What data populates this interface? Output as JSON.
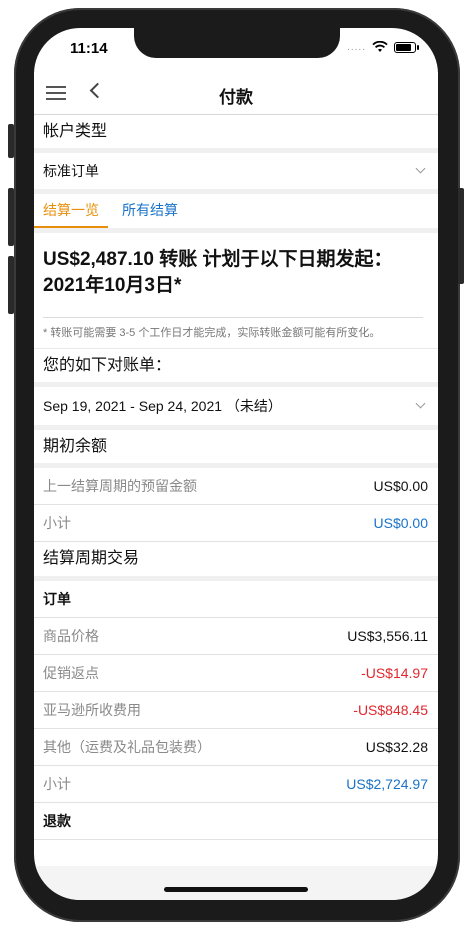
{
  "status": {
    "time": "11:14",
    "signal": "....."
  },
  "nav": {
    "title": "付款"
  },
  "account_type": {
    "heading": "帐户类型",
    "selected": "标准订单"
  },
  "tabs": [
    {
      "label": "结算一览"
    },
    {
      "label": "所有结算"
    }
  ],
  "summary": {
    "amount_text": "US$2,487.10 转账 计划于以下日期发起：2021年10月3日*",
    "note": "* 转账可能需要 3-5 个工作日才能完成，实际转账金额可能有所变化。"
  },
  "statement": {
    "heading": "您的如下对账单：",
    "selected": "Sep 19, 2021 - Sep 24, 2021 （未结）"
  },
  "opening_balance": {
    "heading": "期初余额",
    "rows": [
      {
        "label": "上一结算周期的预留金额",
        "value": "US$0.00"
      },
      {
        "label": "小计",
        "value": "US$0.00"
      }
    ]
  },
  "transactions": {
    "heading": "结算周期交易",
    "orders": {
      "heading": "订单",
      "rows": [
        {
          "label": "商品价格",
          "value": "US$3,556.11"
        },
        {
          "label": "促销返点",
          "value": "-US$14.97"
        },
        {
          "label": "亚马逊所收费用",
          "value": "-US$848.45"
        },
        {
          "label": "其他（运费及礼品包装费）",
          "value": "US$32.28"
        },
        {
          "label": "小计",
          "value": "US$2,724.97"
        }
      ]
    },
    "refunds": {
      "heading": "退款"
    }
  },
  "colors": {
    "accent": "#e8900c",
    "link": "#1a73c8",
    "negative": "#e0282e"
  }
}
